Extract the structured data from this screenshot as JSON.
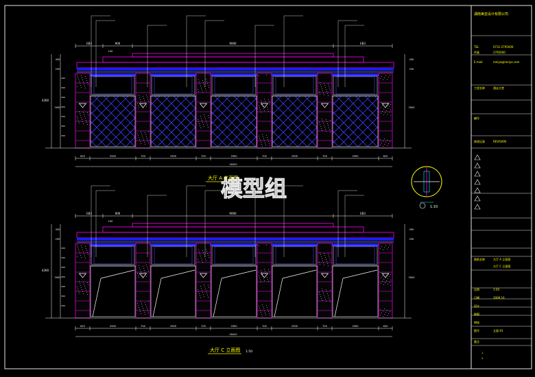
{
  "sheet": {
    "titles": [
      "大厅 A 立面图",
      "大厅 C 立面图"
    ],
    "scales": [
      "1:50",
      "1:50",
      "1:10"
    ],
    "watermark": "模型组"
  },
  "dims": {
    "top": [
      "620",
      "2900",
      "700",
      "2900",
      "700",
      "2900",
      "700",
      "2900",
      "700",
      "2900",
      "620"
    ],
    "top_b": [
      "620",
      "2900",
      "700",
      "2900",
      "700",
      "2900",
      "700",
      "2900",
      "700",
      "2900",
      "620"
    ],
    "total_a": "16420",
    "total_c": "16420",
    "upper_a": [
      "EB3",
      "900",
      "9000",
      "EB3"
    ],
    "upper_c": [
      "EB3",
      "900",
      "9000",
      "EB3"
    ],
    "left_a": [
      "450",
      "250",
      "3000"
    ],
    "left_c": [
      "450",
      "250",
      "3000"
    ],
    "right_a": [
      "450",
      "250",
      "3000"
    ],
    "right_c": [
      "450",
      "250",
      "3000"
    ],
    "h_a": "4300",
    "h_c": "4300",
    "mark": "150"
  },
  "title_block": {
    "company": "湖南美亚设计有限公司",
    "fields": [
      {
        "k": "TEL",
        "v": "0731-2795000"
      },
      {
        "k": "传真",
        "v": "2795000"
      },
      {
        "k": "E-mail",
        "v": "meiya@meiya.com"
      },
      {
        "k": "工程名称",
        "v": "酒店大堂"
      },
      {
        "k": "编号",
        "v": ""
      },
      {
        "k": "修改记录",
        "v": "REVISION"
      },
      {
        "k": "图纸名称",
        "v": "大厅 A 立面图"
      },
      {
        "k": "",
        "v": "大厅 C 立面图"
      },
      {
        "k": "比例",
        "v": "1:50"
      },
      {
        "k": "日期",
        "v": "2009.10"
      },
      {
        "k": "设计",
        "v": ""
      },
      {
        "k": "制图",
        "v": ""
      },
      {
        "k": "审核",
        "v": ""
      },
      {
        "k": "图号",
        "v": "立面-01"
      },
      {
        "k": "备注",
        "v": ""
      }
    ]
  }
}
